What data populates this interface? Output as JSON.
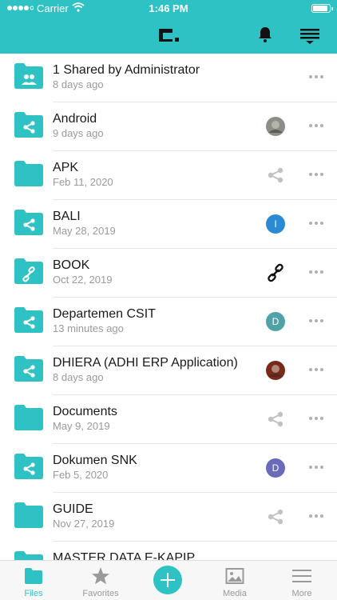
{
  "status_bar": {
    "carrier": "Carrier",
    "time": "1:46 PM"
  },
  "header": {
    "logo_icon": "app-logo-icon",
    "bell_icon": "bell-icon",
    "sort_icon": "sort-icon"
  },
  "colors": {
    "accent": "#2fc2c5",
    "share_grey": "#c2c2c2"
  },
  "files": [
    {
      "name": "1 Shared by Administrator",
      "date": "8 days ago",
      "folder_icon": "group-folder-icon",
      "status_type": "none"
    },
    {
      "name": "Android",
      "date": "9 days ago",
      "folder_icon": "shared-folder-icon",
      "status_type": "photo",
      "photo_color": "#8a8f86"
    },
    {
      "name": "APK",
      "date": "Feb 11, 2020",
      "folder_icon": "folder-icon",
      "status_type": "share"
    },
    {
      "name": "BALI",
      "date": "May 28, 2019",
      "folder_icon": "shared-folder-icon",
      "status_type": "avatar",
      "avatar_letter": "I",
      "avatar_color": "#2a8ad4"
    },
    {
      "name": "BOOK",
      "date": "Oct 22, 2019",
      "folder_icon": "link-folder-icon",
      "status_type": "link"
    },
    {
      "name": "Departemen CSIT",
      "date": "13 minutes ago",
      "folder_icon": "shared-folder-icon",
      "status_type": "avatar",
      "avatar_letter": "D",
      "avatar_color": "#4fa3a8"
    },
    {
      "name": "DHIERA (ADHI ERP Application)",
      "date": "8 days ago",
      "folder_icon": "shared-folder-icon",
      "status_type": "photo",
      "photo_color": "#7a2a1a"
    },
    {
      "name": "Documents",
      "date": "May 9, 2019",
      "folder_icon": "folder-icon",
      "status_type": "share"
    },
    {
      "name": "Dokumen SNK",
      "date": "Feb 5, 2020",
      "folder_icon": "shared-folder-icon",
      "status_type": "avatar",
      "avatar_letter": "D",
      "avatar_color": "#6a6aba"
    },
    {
      "name": "GUIDE",
      "date": "Nov 27, 2019",
      "folder_icon": "folder-icon",
      "status_type": "share"
    },
    {
      "name": "MASTER DATA E-KAPIP",
      "date": "",
      "folder_icon": "folder-icon",
      "status_type": "none"
    }
  ],
  "tabs": [
    {
      "label": "Files",
      "icon": "folder-icon",
      "active": true
    },
    {
      "label": "Favorites",
      "icon": "star-icon",
      "active": false
    },
    {
      "label": "",
      "icon": "plus-icon",
      "active": false
    },
    {
      "label": "Media",
      "icon": "image-icon",
      "active": false
    },
    {
      "label": "More",
      "icon": "menu-icon",
      "active": false
    }
  ]
}
